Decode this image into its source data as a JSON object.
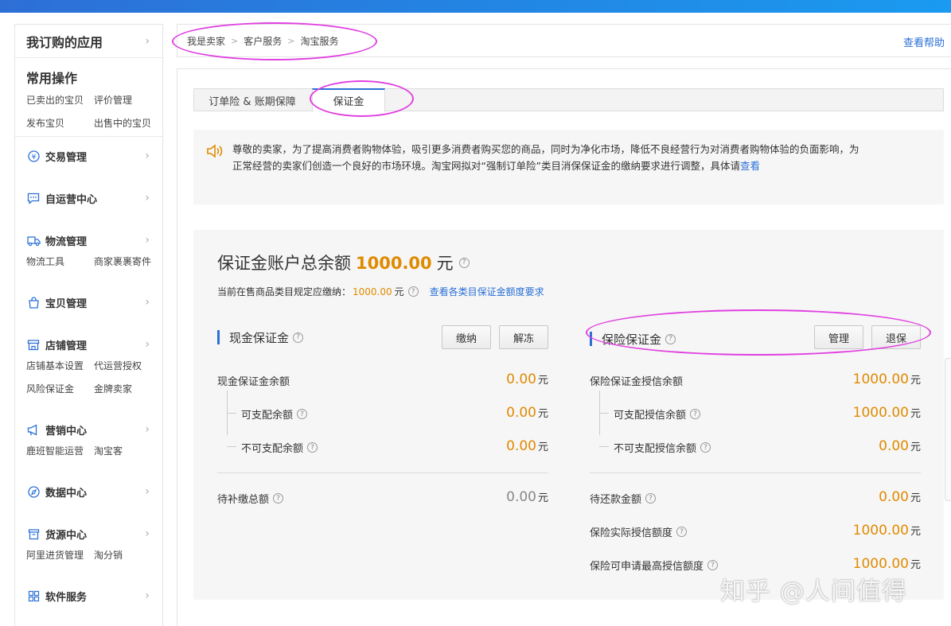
{
  "sidebar": {
    "my_apps": "我订购的应用",
    "common": {
      "title": "常用操作",
      "links": [
        "已卖出的宝贝",
        "评价管理",
        "发布宝贝",
        "出售中的宝贝"
      ]
    },
    "sections": [
      {
        "label": "交易管理",
        "icon": "yen-circle-icon",
        "links": []
      },
      {
        "label": "自运营中心",
        "icon": "chat-bubble-icon",
        "links": []
      },
      {
        "label": "物流管理",
        "icon": "truck-icon",
        "links": [
          "物流工具",
          "商家裹裹寄件"
        ]
      },
      {
        "label": "宝贝管理",
        "icon": "bag-icon",
        "links": []
      },
      {
        "label": "店铺管理",
        "icon": "store-icon",
        "links": [
          "店铺基本设置",
          "代运营授权",
          "风险保证金",
          "金牌卖家"
        ]
      },
      {
        "label": "营销中心",
        "icon": "megaphone-icon",
        "links": [
          "鹿班智能运营",
          "淘宝客"
        ]
      },
      {
        "label": "数据中心",
        "icon": "compass-icon",
        "links": []
      },
      {
        "label": "货源中心",
        "icon": "box-icon",
        "links": [
          "阿里进货管理",
          "淘分销"
        ]
      },
      {
        "label": "软件服务",
        "icon": "grid-icon",
        "links": []
      }
    ]
  },
  "breadcrumb": [
    "我是卖家",
    "客户服务",
    "淘宝服务"
  ],
  "help": "查看帮助",
  "tabs": [
    "订单险 & 账期保障",
    "保证金"
  ],
  "notice": {
    "text": "尊敬的卖家，为了提高消费者购物体验，吸引更多消费者购买您的商品，同时为净化市场，降低不良经营行为对消费者购物体验的负面影响，为正常经营的卖家们创造一个良好的市场环境。淘宝网拟对“强制订单险”类目消保保证金的缴纳要求进行调整，具体请",
    "link": "查看"
  },
  "summary": {
    "title": "保证金账户总余额",
    "amount": "1000.00",
    "unit": "元",
    "required_label": "当前在售商品类目规定应缴纳：",
    "required_value": "1000.00",
    "required_unit": "元",
    "link": "查看各类目保证金额度要求"
  },
  "cash": {
    "title": "现金保证金",
    "buttons": [
      "缴纳",
      "解冻"
    ],
    "rows": [
      {
        "label": "现金保证金余额",
        "value": "0.00",
        "unit": "元"
      },
      {
        "label": "可支配余额",
        "value": "0.00",
        "unit": "元"
      },
      {
        "label": "不可支配余额",
        "value": "0.00",
        "unit": "元"
      },
      {
        "label": "待补缴总额",
        "value": "0.00",
        "unit": "元"
      }
    ]
  },
  "insurance": {
    "title": "保险保证金",
    "buttons": [
      "管理",
      "退保"
    ],
    "rows": [
      {
        "label": "保险保证金授信余额",
        "value": "1000.00",
        "unit": "元"
      },
      {
        "label": "可支配授信余额",
        "value": "1000.00",
        "unit": "元"
      },
      {
        "label": "不可支配授信余额",
        "value": "0.00",
        "unit": "元"
      },
      {
        "label": "待还款金额",
        "value": "0.00",
        "unit": "元"
      },
      {
        "label": "保险实际授信额度",
        "value": "1000.00",
        "unit": "元"
      },
      {
        "label": "保险可申请最高授信额度",
        "value": "1000.00",
        "unit": "元"
      }
    ]
  },
  "watermark": "知乎 @人间值得",
  "colors": {
    "accent": "#2b70d6",
    "amount": "#e08a00",
    "annotation": "#e040e0"
  }
}
